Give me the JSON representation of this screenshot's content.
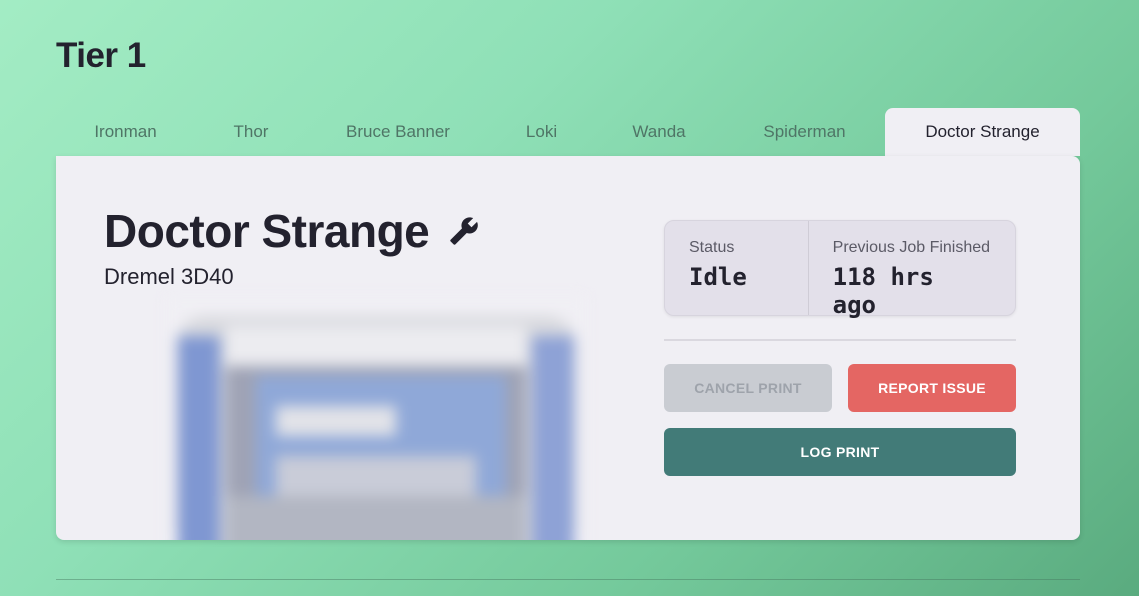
{
  "page": {
    "title": "Tier 1"
  },
  "tabs": [
    {
      "label": "Ironman",
      "active": false
    },
    {
      "label": "Thor",
      "active": false
    },
    {
      "label": "Bruce Banner",
      "active": false
    },
    {
      "label": "Loki",
      "active": false
    },
    {
      "label": "Wanda",
      "active": false
    },
    {
      "label": "Spiderman",
      "active": false
    },
    {
      "label": "Doctor Strange",
      "active": true
    }
  ],
  "printer": {
    "name": "Doctor Strange",
    "model": "Dremel 3D40",
    "settings_icon": "wrench-icon",
    "image": "printer-photo"
  },
  "status": {
    "status_label": "Status",
    "status_value": "Idle",
    "previous_label": "Previous Job Finished",
    "previous_value": "118 hrs ago"
  },
  "actions": {
    "cancel_label": "CANCEL PRINT",
    "cancel_enabled": false,
    "report_label": "REPORT ISSUE",
    "log_label": "LOG PRINT"
  },
  "colors": {
    "background_gradient": [
      "#a3ecc4",
      "#5aab7f"
    ],
    "panel": "#f0eff4",
    "text": "#23222e",
    "report": "#e46663",
    "log": "#427b78",
    "disabled": "#c9ccd2"
  }
}
